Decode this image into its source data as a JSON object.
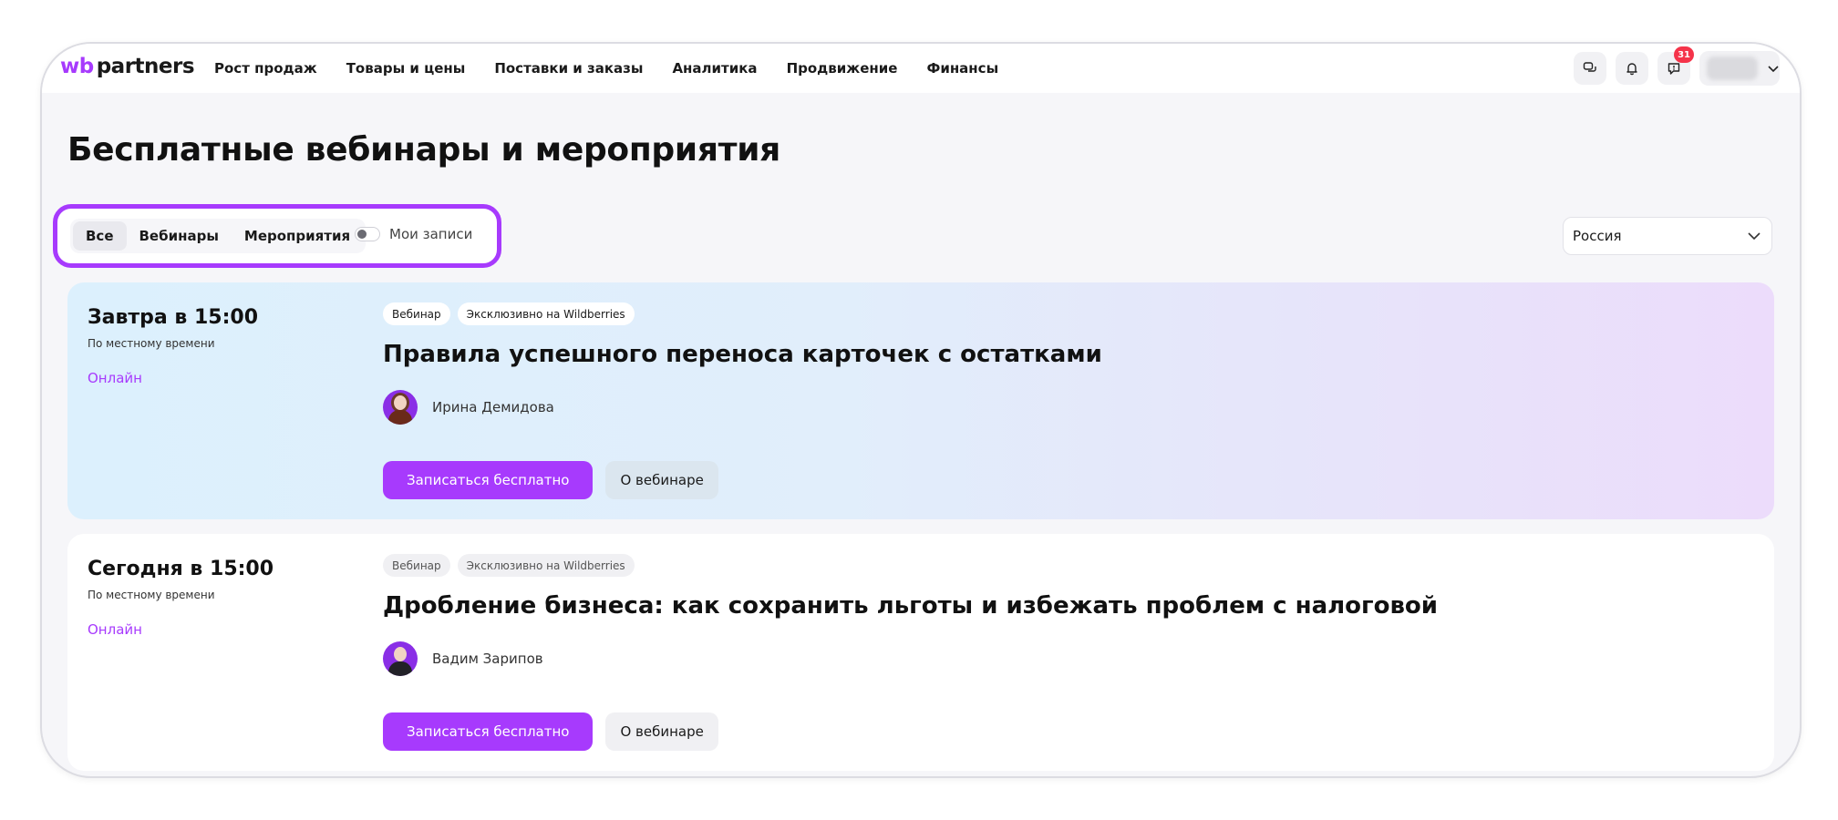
{
  "brand": {
    "logo_wb": "wb",
    "logo_partners": "partners",
    "accent_color": "#a73afd"
  },
  "nav": {
    "items": [
      "Рост продаж",
      "Товары и цены",
      "Поставки и заказы",
      "Аналитика",
      "Продвижение",
      "Финансы"
    ]
  },
  "header_actions": {
    "chat_icon": "chat-icon",
    "bell_icon": "bell-icon",
    "support_icon": "support-icon",
    "notifications_count": "31"
  },
  "page": {
    "title": "Бесплатные вебинары и мероприятия"
  },
  "filters": {
    "tabs": [
      "Все",
      "Вебинары",
      "Мероприятия"
    ],
    "active_tab": "Все",
    "my_records_label": "Мои записи",
    "region_value": "Россия"
  },
  "events": [
    {
      "when": "Завтра в 15:00",
      "tz": "По местному времени",
      "format": "Онлайн",
      "tags": [
        "Вебинар",
        "Эксклюзивно на Wildberries"
      ],
      "title": "Правила успешного переноса карточек с остатками",
      "speaker": "Ирина Демидова",
      "primary_action": "Записаться бесплатно",
      "secondary_action": "О вебинаре"
    },
    {
      "when": "Сегодня в 15:00",
      "tz": "По местному времени",
      "format": "Онлайн",
      "tags": [
        "Вебинар",
        "Эксклюзивно на Wildberries"
      ],
      "title": "Дробление бизнеса: как сохранить льготы и избежать проблем с налоговой",
      "speaker": "Вадим Зарипов",
      "primary_action": "Записаться бесплатно",
      "secondary_action": "О вебинаре"
    }
  ]
}
